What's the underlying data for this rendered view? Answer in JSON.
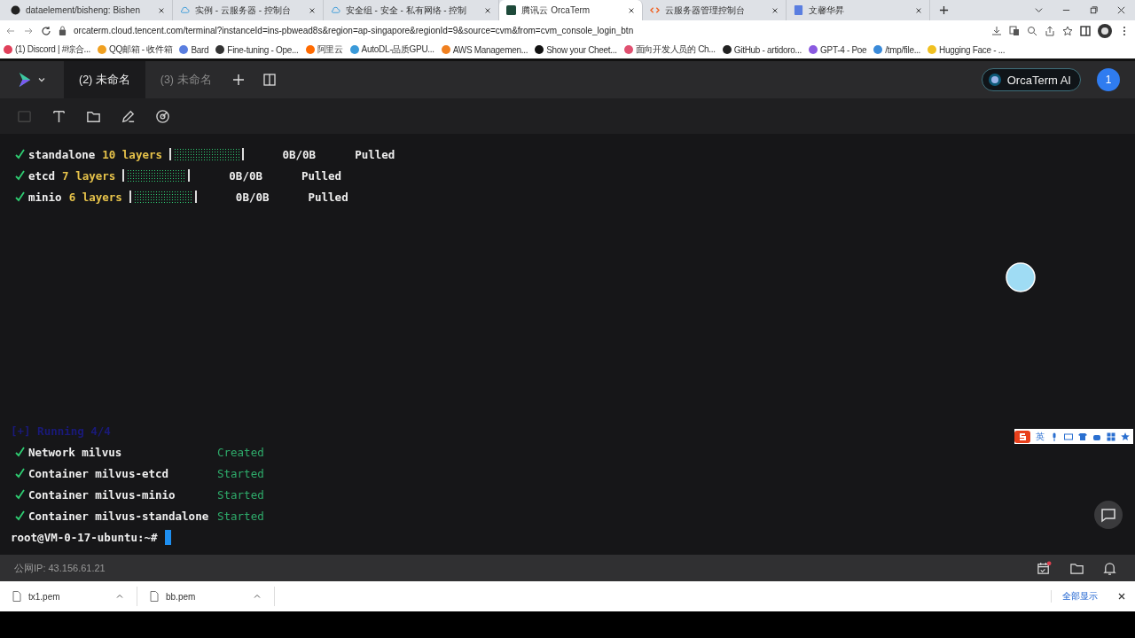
{
  "browser": {
    "tabs": [
      {
        "title": "dataelement/bisheng: Bishen",
        "kind": "github",
        "selected": false
      },
      {
        "title": "实例 - 云服务器 - 控制台",
        "kind": "cloud",
        "selected": false
      },
      {
        "title": "安全组 - 安全 - 私有网络 - 控制",
        "kind": "cloud",
        "selected": false
      },
      {
        "title": "腾讯云 OrcaTerm",
        "kind": "term",
        "selected": true
      },
      {
        "title": "云服务器管理控制台",
        "kind": "bracket",
        "selected": false
      },
      {
        "title": "文馨华昇",
        "kind": "doc",
        "selected": false
      }
    ],
    "address": "orcaterm.cloud.tencent.com/terminal?instanceId=ins-pbwead8s&region=ap-singapore&regionId=9&source=cvm&from=cvm_console_login_btn",
    "bookmarks": [
      {
        "title": "(1) Discord | #综合...",
        "color": "#e0405a"
      },
      {
        "title": "QQ邮箱 - 收件箱",
        "color": "#f0a020"
      },
      {
        "title": "Bard",
        "color": "#5a7ee0"
      },
      {
        "title": "Fine-tuning - Ope...",
        "color": "#333333"
      },
      {
        "title": "阿里云",
        "color": "#ff6a00"
      },
      {
        "title": "AutoDL-品质GPU...",
        "color": "#3a9ad9"
      },
      {
        "title": "AWS Managemen...",
        "color": "#f08020"
      },
      {
        "title": "Show your Cheet...",
        "color": "#111111"
      },
      {
        "title": "面向开发人员的 Ch...",
        "color": "#e05070"
      },
      {
        "title": "GitHub - artidoro...",
        "color": "#222222"
      },
      {
        "title": "GPT-4 - Poe",
        "color": "#8a5ae0"
      },
      {
        "title": "/tmp/file...",
        "color": "#3a8ad9"
      },
      {
        "title": "Hugging Face - ...",
        "color": "#f0c020"
      }
    ]
  },
  "app": {
    "sessions": [
      {
        "label": "(2) 未命名",
        "selected": true
      },
      {
        "label": "(3) 未命名",
        "selected": false
      }
    ],
    "ai_button": "OrcaTerm AI",
    "avatar": "1"
  },
  "toolbar": [
    {
      "kind": "image",
      "disabled": true
    },
    {
      "kind": "text",
      "disabled": false
    },
    {
      "kind": "folder",
      "disabled": false
    },
    {
      "kind": "pen",
      "disabled": false
    },
    {
      "kind": "target",
      "disabled": false
    }
  ],
  "terminal": {
    "pulls": [
      {
        "name": "standalone",
        "layers": "10 layers",
        "level": 1,
        "size": "0B/0B",
        "status": "Pulled"
      },
      {
        "name": "etcd",
        "layers": "7 layers",
        "level": 1,
        "size": "0B/0B",
        "status": "Pulled"
      },
      {
        "name": "minio",
        "layers": "6 layers",
        "level": 1,
        "size": "0B/0B",
        "status": "Pulled"
      }
    ],
    "running": "[+] Running 4/4",
    "steps": [
      {
        "name": "Network milvus",
        "status": "Created"
      },
      {
        "name": "Container milvus-etcd",
        "status": "Started"
      },
      {
        "name": "Container milvus-minio",
        "status": "Started"
      },
      {
        "name": "Container milvus-standalone",
        "status": "Started"
      }
    ],
    "prompt": "root@VM-0-17-ubuntu:~#"
  },
  "ime": {
    "mode": "英"
  },
  "status_bar": {
    "ip": "公网IP: 43.156.61.21",
    "calendar_badge": true
  },
  "downloads": {
    "files": [
      "tx1.pem",
      "bb.pem"
    ],
    "show_all": "全部显示"
  }
}
